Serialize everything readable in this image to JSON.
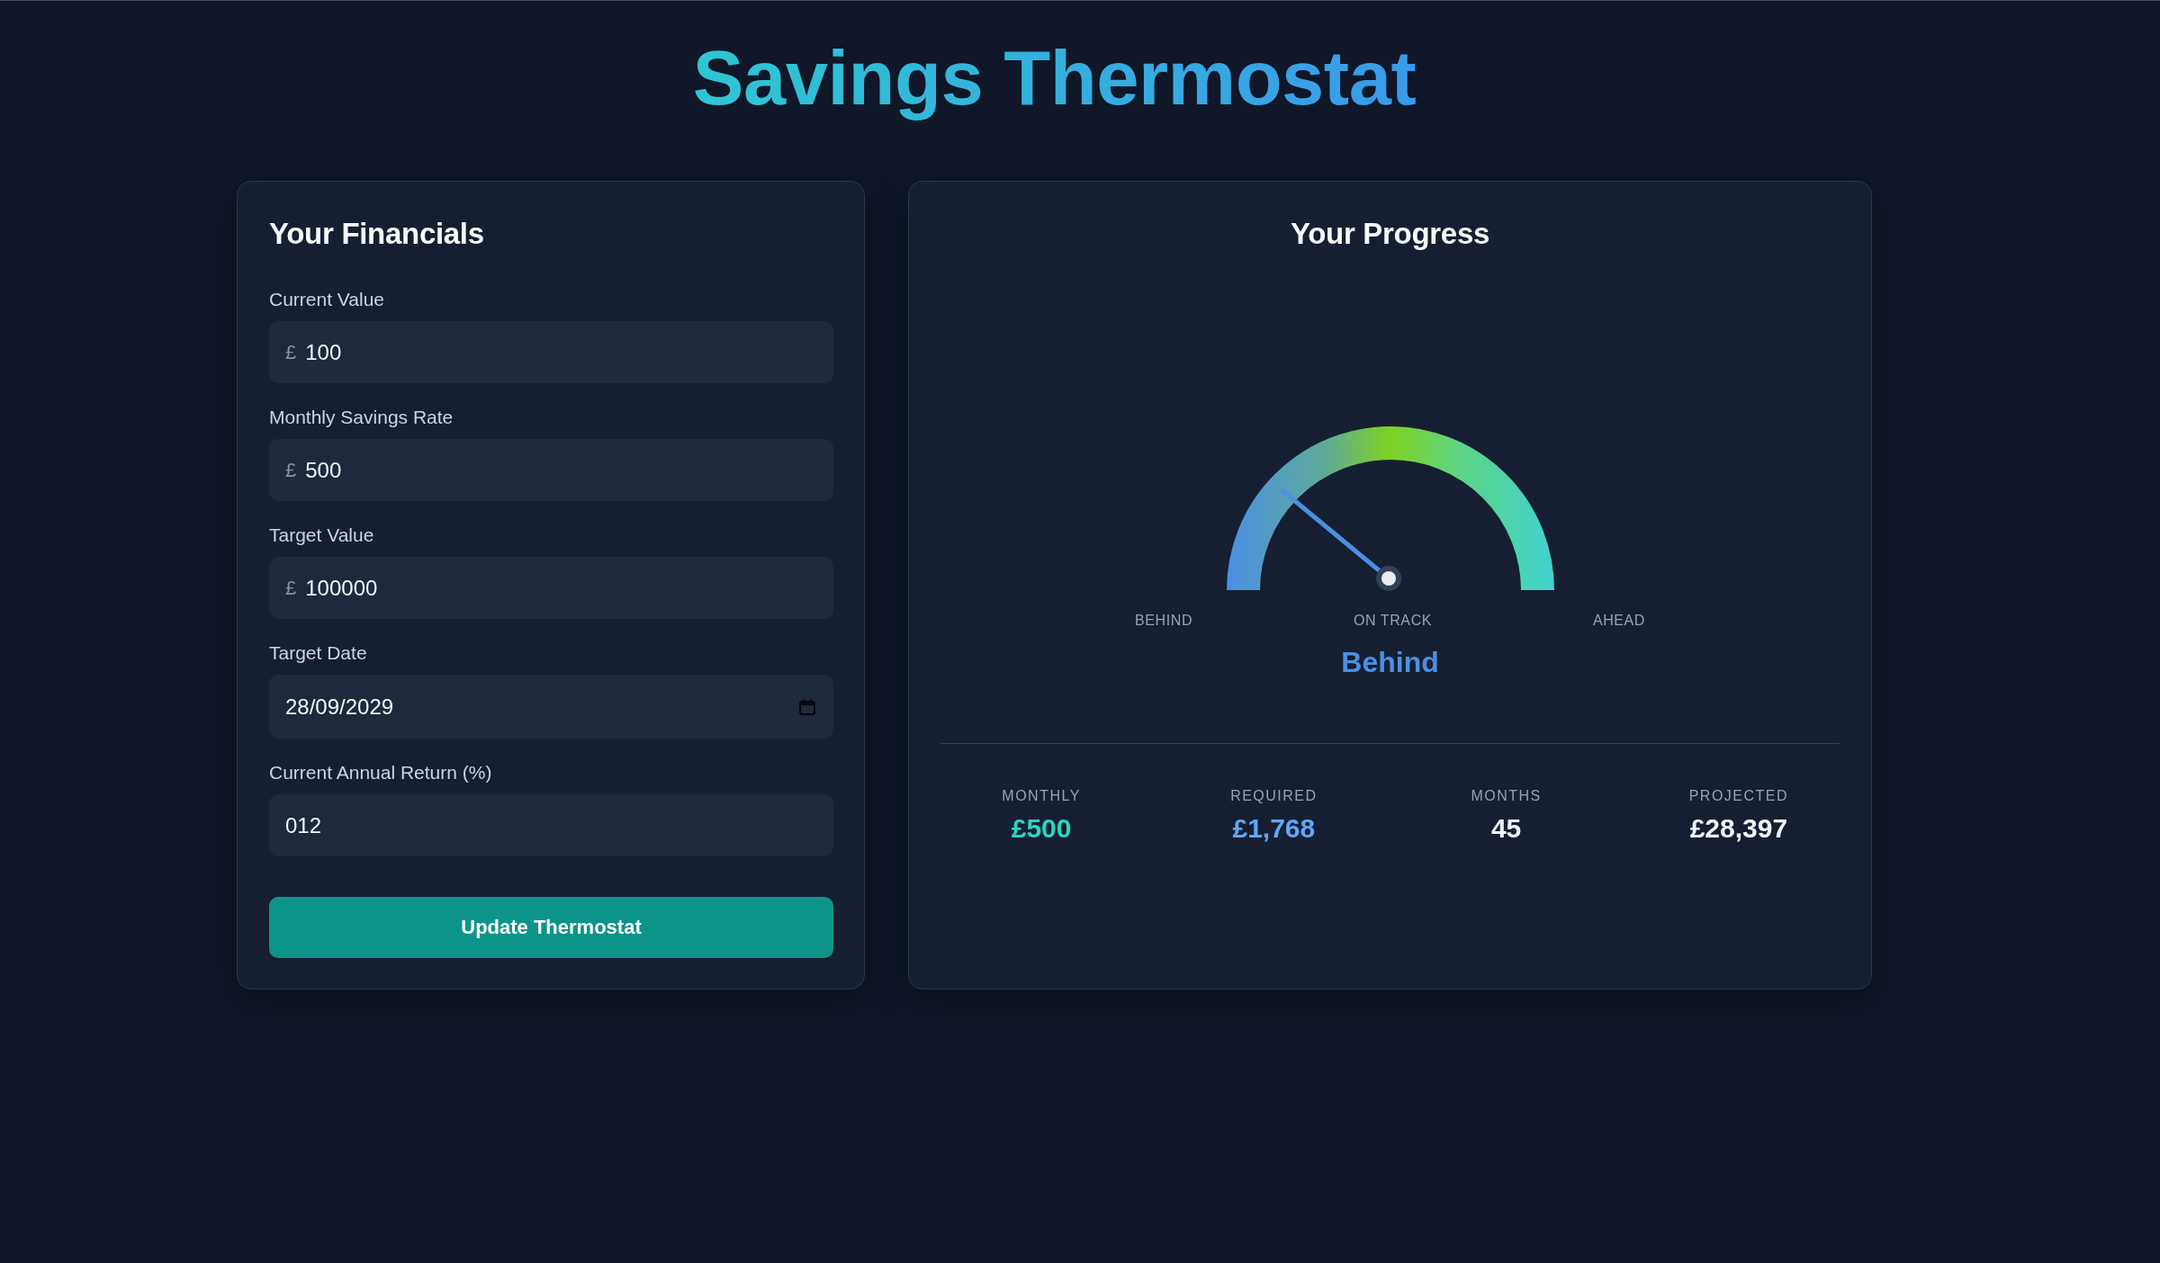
{
  "title": "Savings Thermostat",
  "financials": {
    "heading": "Your Financials",
    "fields": [
      {
        "kind": "currency",
        "label": "Current Value",
        "prefix": "£",
        "value": "100"
      },
      {
        "kind": "currency",
        "label": "Monthly Savings Rate",
        "prefix": "£",
        "value": "500"
      },
      {
        "kind": "currency",
        "label": "Target Value",
        "prefix": "£",
        "value": "100000"
      },
      {
        "kind": "date",
        "label": "Target Date",
        "value": "28/09/2029"
      },
      {
        "kind": "number",
        "label": "Current Annual Return (%)",
        "value": "012"
      }
    ],
    "button": "Update Thermostat"
  },
  "progress": {
    "heading": "Your Progress",
    "gauge": {
      "level": 0.22,
      "scale_labels": [
        "BEHIND",
        "ON TRACK",
        "AHEAD"
      ]
    },
    "status": "Behind",
    "stats": [
      {
        "label": "MONTHLY",
        "value": "£500",
        "color": "#2dd4bf"
      },
      {
        "label": "REQUIRED",
        "value": "£1,768",
        "color": "#60a5fa"
      },
      {
        "label": "MONTHS",
        "value": "45",
        "color": "#f1f5f9"
      },
      {
        "label": "PROJECTED",
        "value": "£28,397",
        "color": "#f1f5f9"
      }
    ]
  }
}
